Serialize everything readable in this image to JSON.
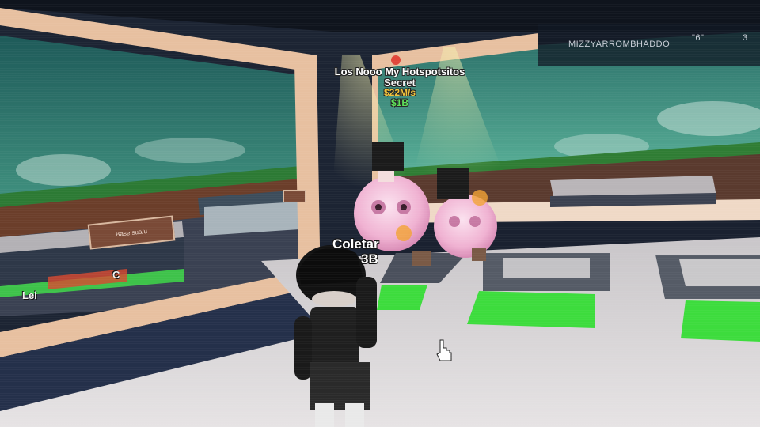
{
  "billboard": {
    "title": "Los Nooo My Hotspotsitos",
    "rarity": "Secret",
    "rate": "$22M/s",
    "price": "$1B"
  },
  "scoreboard": {
    "player_name": "MIZZYARROMBHADDO",
    "value": "\"6\"",
    "count": "3"
  },
  "collect": {
    "label": "Coletar",
    "amount": "3B"
  },
  "signs": {
    "base_sign": "Base sua/u",
    "left_fragment": "Lei",
    "left_fragment2": "C"
  },
  "colors": {
    "sky": "#3b8f7c",
    "frame": "#e9c3a3",
    "floor": "#d9d6d6",
    "collect_pad": "#3ddc3d",
    "pink_brainrot": "#f2b6d6"
  },
  "icons": {
    "cursor": "hand-pointer-icon"
  }
}
